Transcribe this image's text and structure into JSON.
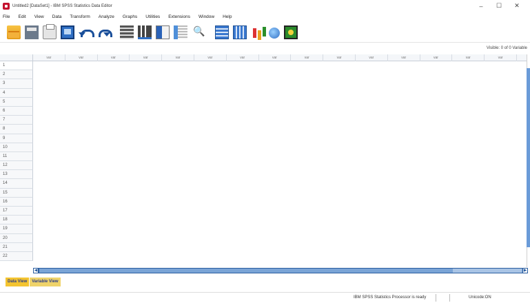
{
  "window": {
    "title": "Untitled2 [DataSet1] - IBM SPSS Statistics Data Editor",
    "minimize": "–",
    "maximize": "☐",
    "close": "✕"
  },
  "menu": [
    "File",
    "Edit",
    "View",
    "Data",
    "Transform",
    "Analyze",
    "Graphs",
    "Utilities",
    "Extensions",
    "Window",
    "Help"
  ],
  "toolbar": {
    "icons": [
      "open-data-icon",
      "save-icon",
      "print-icon",
      "recall-dialog-icon",
      "undo-icon",
      "redo-icon",
      "go-to-case-icon",
      "go-to-variable-icon",
      "variables-icon",
      "descriptive-stats-icon",
      "find-icon",
      "insert-cases-icon",
      "insert-variable-icon",
      "split-file-icon",
      "weight-cases-icon",
      "select-cases-icon"
    ]
  },
  "visible_variables": "Visible: 0 of 0 Variable",
  "grid": {
    "column_headers": [
      "var",
      "var",
      "var",
      "var",
      "var",
      "var",
      "var",
      "var",
      "var",
      "var",
      "var",
      "var",
      "var",
      "var",
      "var"
    ],
    "row_headers": [
      "1",
      "2",
      "3",
      "4",
      "5",
      "6",
      "7",
      "8",
      "9",
      "10",
      "11",
      "12",
      "13",
      "14",
      "15",
      "16",
      "17",
      "18",
      "19",
      "20",
      "21",
      "22"
    ]
  },
  "tabs": {
    "data_view": "Data View",
    "variable_view": "Variable View"
  },
  "status": {
    "processor": "IBM SPSS Statistics Processor is ready",
    "unicode": "Unicode:ON"
  },
  "colors": {
    "tab_active": "#f4c430",
    "scroll_accent": "#2a5d9f"
  }
}
